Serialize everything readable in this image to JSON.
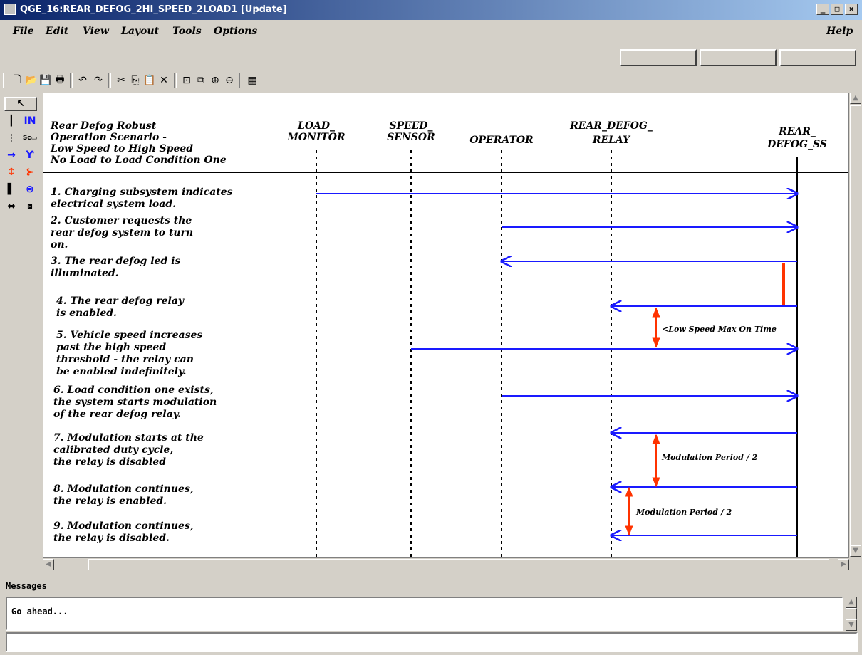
{
  "window": {
    "title": "QGE_16:REAR_DEFOG_2HI_SPEED_2LOAD1  [Update]",
    "controls": [
      "_",
      "□",
      "×"
    ]
  },
  "menu": {
    "items": [
      "File",
      "Edit",
      "View",
      "Layout",
      "Tools",
      "Options"
    ],
    "help": "Help"
  },
  "toolbar": {
    "icons": [
      "new-icon",
      "open-icon",
      "save-icon",
      "print-icon",
      "undo-icon",
      "redo-icon",
      "cut-icon",
      "copy-icon",
      "paste-icon",
      "delete-icon",
      "fit-icon",
      "zoom-area-icon",
      "zoom-in-icon",
      "zoom-out-icon",
      "grid-icon"
    ]
  },
  "palette": {
    "tools": [
      "select-arrow-icon",
      "lifeline-icon",
      "note-icon",
      "message-arrow-icon",
      "time-constraint-icon",
      "activation-bar-icon",
      "move-icon"
    ]
  },
  "diagram": {
    "title_lines": [
      "Rear Defog Robust",
      "Operation Scenario -",
      "Low Speed to High Speed",
      "No Load to Load Condition One"
    ],
    "lifelines": [
      {
        "label_lines": [
          "LOAD_",
          "MONITOR"
        ]
      },
      {
        "label_lines": [
          "SPEED_",
          "SENSOR"
        ]
      },
      {
        "label_lines": [
          "OPERATOR"
        ]
      },
      {
        "label_lines": [
          "REAR_DEFOG_",
          "RELAY"
        ]
      },
      {
        "label_lines": [
          "REAR_",
          "DEFOG_SS"
        ]
      }
    ],
    "steps": [
      {
        "lines": [
          "1. Charging subsystem indicates",
          "electrical system load."
        ]
      },
      {
        "lines": [
          "2. Customer requests the",
          "rear defog system to turn",
          "on."
        ]
      },
      {
        "lines": [
          "3. The rear defog led is",
          "illuminated."
        ]
      },
      {
        "lines": [
          "4. The rear defog relay",
          "is enabled."
        ]
      },
      {
        "lines": [
          "5. Vehicle speed increases",
          "past the high speed",
          "threshold - the relay can",
          "be enabled indefinitely."
        ]
      },
      {
        "lines": [
          "6. Load condition one exists,",
          "the system starts modulation",
          "of the rear defog relay."
        ]
      },
      {
        "lines": [
          "7. Modulation starts at the",
          "calibrated duty cycle,",
          "the relay is disabled"
        ]
      },
      {
        "lines": [
          "8. Modulation continues,",
          "the relay is enabled."
        ]
      },
      {
        "lines": [
          "9. Modulation continues,",
          "the relay is disabled."
        ]
      }
    ],
    "constraints": [
      {
        "label": "<Low Speed Max On Time"
      },
      {
        "label": "Modulation Period / 2"
      },
      {
        "label": "Modulation Period / 2"
      }
    ],
    "colors": {
      "message": "#1a1aff",
      "constraint": "#ff3300",
      "activation": "#ff3300",
      "lifeline": "#000000"
    }
  },
  "messages": {
    "label": "Messages",
    "text": "Go ahead..."
  },
  "command": {
    "value": ""
  }
}
